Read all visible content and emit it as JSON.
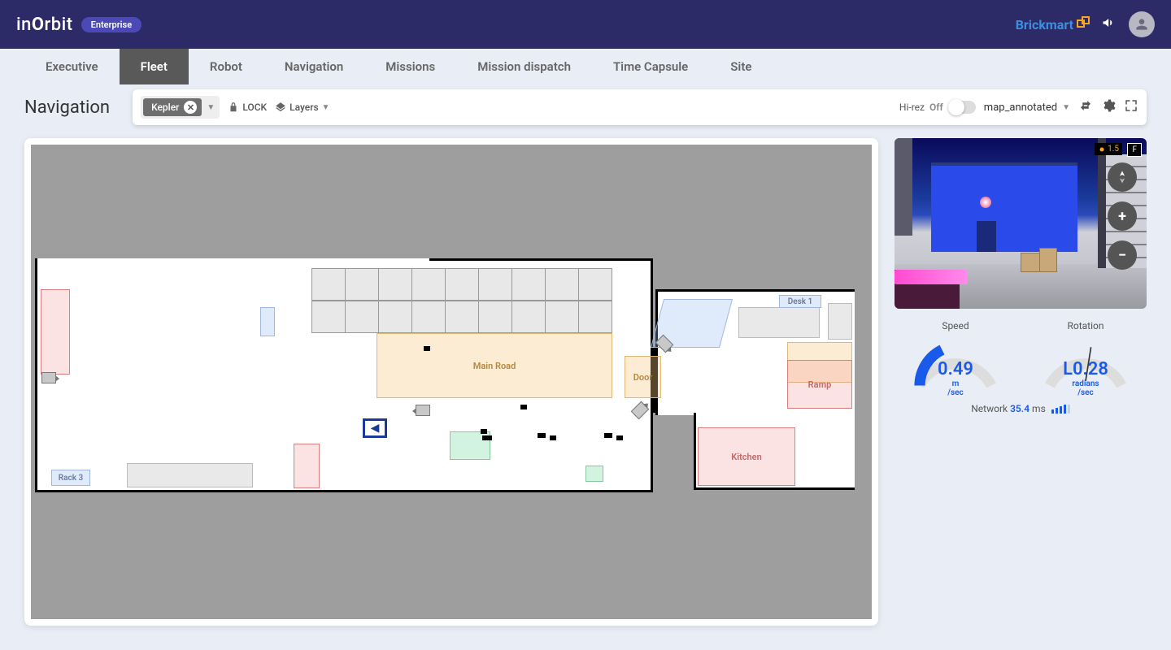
{
  "header": {
    "logo_prefix": "in",
    "logo_accent": "O",
    "logo_suffix": "rbit",
    "plan": "Enterprise",
    "brand": "Brickmart"
  },
  "tabs": [
    "Executive",
    "Fleet",
    "Robot",
    "Navigation",
    "Missions",
    "Mission dispatch",
    "Time Capsule",
    "Site"
  ],
  "active_tab": "Fleet",
  "page_title": "Navigation",
  "toolbar": {
    "robot": "Kepler",
    "lock": "LOCK",
    "layers": "Layers",
    "hirez_label": "Hi-rez",
    "hirez_state": "Off",
    "map_name": "map_annotated"
  },
  "map": {
    "zones": {
      "main_road": "Main Road",
      "door": "Door",
      "ramp": "Ramp",
      "kitchen": "Kitchen",
      "desk1": "Desk 1",
      "rack3": "Rack 3"
    }
  },
  "camera": {
    "latency_badge": "1.5",
    "mode_badge": "F"
  },
  "telemetry": {
    "speed": {
      "title": "Speed",
      "value": "0.49",
      "unit1": "m",
      "unit2": "/sec"
    },
    "rotation": {
      "title": "Rotation",
      "value": "L0.28",
      "unit1": "radians",
      "unit2": "/sec"
    },
    "network_label": "Network",
    "network_value": "35.4",
    "network_unit": "ms"
  }
}
